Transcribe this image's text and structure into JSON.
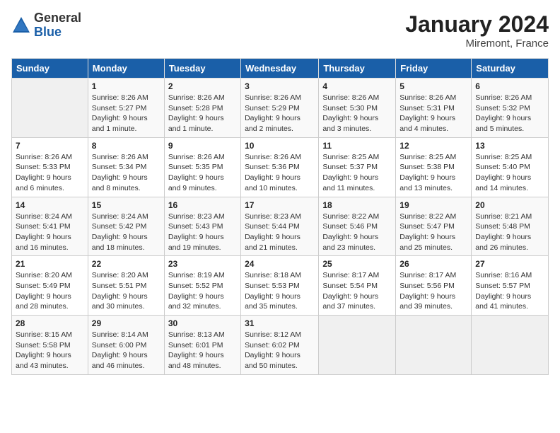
{
  "header": {
    "logo_general": "General",
    "logo_blue": "Blue",
    "month_year": "January 2024",
    "location": "Miremont, France"
  },
  "days_of_week": [
    "Sunday",
    "Monday",
    "Tuesday",
    "Wednesday",
    "Thursday",
    "Friday",
    "Saturday"
  ],
  "weeks": [
    [
      {
        "day": "",
        "info": ""
      },
      {
        "day": "1",
        "info": "Sunrise: 8:26 AM\nSunset: 5:27 PM\nDaylight: 9 hours\nand 1 minute."
      },
      {
        "day": "2",
        "info": "Sunrise: 8:26 AM\nSunset: 5:28 PM\nDaylight: 9 hours\nand 1 minute."
      },
      {
        "day": "3",
        "info": "Sunrise: 8:26 AM\nSunset: 5:29 PM\nDaylight: 9 hours\nand 2 minutes."
      },
      {
        "day": "4",
        "info": "Sunrise: 8:26 AM\nSunset: 5:30 PM\nDaylight: 9 hours\nand 3 minutes."
      },
      {
        "day": "5",
        "info": "Sunrise: 8:26 AM\nSunset: 5:31 PM\nDaylight: 9 hours\nand 4 minutes."
      },
      {
        "day": "6",
        "info": "Sunrise: 8:26 AM\nSunset: 5:32 PM\nDaylight: 9 hours\nand 5 minutes."
      }
    ],
    [
      {
        "day": "7",
        "info": "Sunrise: 8:26 AM\nSunset: 5:33 PM\nDaylight: 9 hours\nand 6 minutes."
      },
      {
        "day": "8",
        "info": "Sunrise: 8:26 AM\nSunset: 5:34 PM\nDaylight: 9 hours\nand 8 minutes."
      },
      {
        "day": "9",
        "info": "Sunrise: 8:26 AM\nSunset: 5:35 PM\nDaylight: 9 hours\nand 9 minutes."
      },
      {
        "day": "10",
        "info": "Sunrise: 8:26 AM\nSunset: 5:36 PM\nDaylight: 9 hours\nand 10 minutes."
      },
      {
        "day": "11",
        "info": "Sunrise: 8:25 AM\nSunset: 5:37 PM\nDaylight: 9 hours\nand 11 minutes."
      },
      {
        "day": "12",
        "info": "Sunrise: 8:25 AM\nSunset: 5:38 PM\nDaylight: 9 hours\nand 13 minutes."
      },
      {
        "day": "13",
        "info": "Sunrise: 8:25 AM\nSunset: 5:40 PM\nDaylight: 9 hours\nand 14 minutes."
      }
    ],
    [
      {
        "day": "14",
        "info": "Sunrise: 8:24 AM\nSunset: 5:41 PM\nDaylight: 9 hours\nand 16 minutes."
      },
      {
        "day": "15",
        "info": "Sunrise: 8:24 AM\nSunset: 5:42 PM\nDaylight: 9 hours\nand 18 minutes."
      },
      {
        "day": "16",
        "info": "Sunrise: 8:23 AM\nSunset: 5:43 PM\nDaylight: 9 hours\nand 19 minutes."
      },
      {
        "day": "17",
        "info": "Sunrise: 8:23 AM\nSunset: 5:44 PM\nDaylight: 9 hours\nand 21 minutes."
      },
      {
        "day": "18",
        "info": "Sunrise: 8:22 AM\nSunset: 5:46 PM\nDaylight: 9 hours\nand 23 minutes."
      },
      {
        "day": "19",
        "info": "Sunrise: 8:22 AM\nSunset: 5:47 PM\nDaylight: 9 hours\nand 25 minutes."
      },
      {
        "day": "20",
        "info": "Sunrise: 8:21 AM\nSunset: 5:48 PM\nDaylight: 9 hours\nand 26 minutes."
      }
    ],
    [
      {
        "day": "21",
        "info": "Sunrise: 8:20 AM\nSunset: 5:49 PM\nDaylight: 9 hours\nand 28 minutes."
      },
      {
        "day": "22",
        "info": "Sunrise: 8:20 AM\nSunset: 5:51 PM\nDaylight: 9 hours\nand 30 minutes."
      },
      {
        "day": "23",
        "info": "Sunrise: 8:19 AM\nSunset: 5:52 PM\nDaylight: 9 hours\nand 32 minutes."
      },
      {
        "day": "24",
        "info": "Sunrise: 8:18 AM\nSunset: 5:53 PM\nDaylight: 9 hours\nand 35 minutes."
      },
      {
        "day": "25",
        "info": "Sunrise: 8:17 AM\nSunset: 5:54 PM\nDaylight: 9 hours\nand 37 minutes."
      },
      {
        "day": "26",
        "info": "Sunrise: 8:17 AM\nSunset: 5:56 PM\nDaylight: 9 hours\nand 39 minutes."
      },
      {
        "day": "27",
        "info": "Sunrise: 8:16 AM\nSunset: 5:57 PM\nDaylight: 9 hours\nand 41 minutes."
      }
    ],
    [
      {
        "day": "28",
        "info": "Sunrise: 8:15 AM\nSunset: 5:58 PM\nDaylight: 9 hours\nand 43 minutes."
      },
      {
        "day": "29",
        "info": "Sunrise: 8:14 AM\nSunset: 6:00 PM\nDaylight: 9 hours\nand 46 minutes."
      },
      {
        "day": "30",
        "info": "Sunrise: 8:13 AM\nSunset: 6:01 PM\nDaylight: 9 hours\nand 48 minutes."
      },
      {
        "day": "31",
        "info": "Sunrise: 8:12 AM\nSunset: 6:02 PM\nDaylight: 9 hours\nand 50 minutes."
      },
      {
        "day": "",
        "info": ""
      },
      {
        "day": "",
        "info": ""
      },
      {
        "day": "",
        "info": ""
      }
    ]
  ]
}
